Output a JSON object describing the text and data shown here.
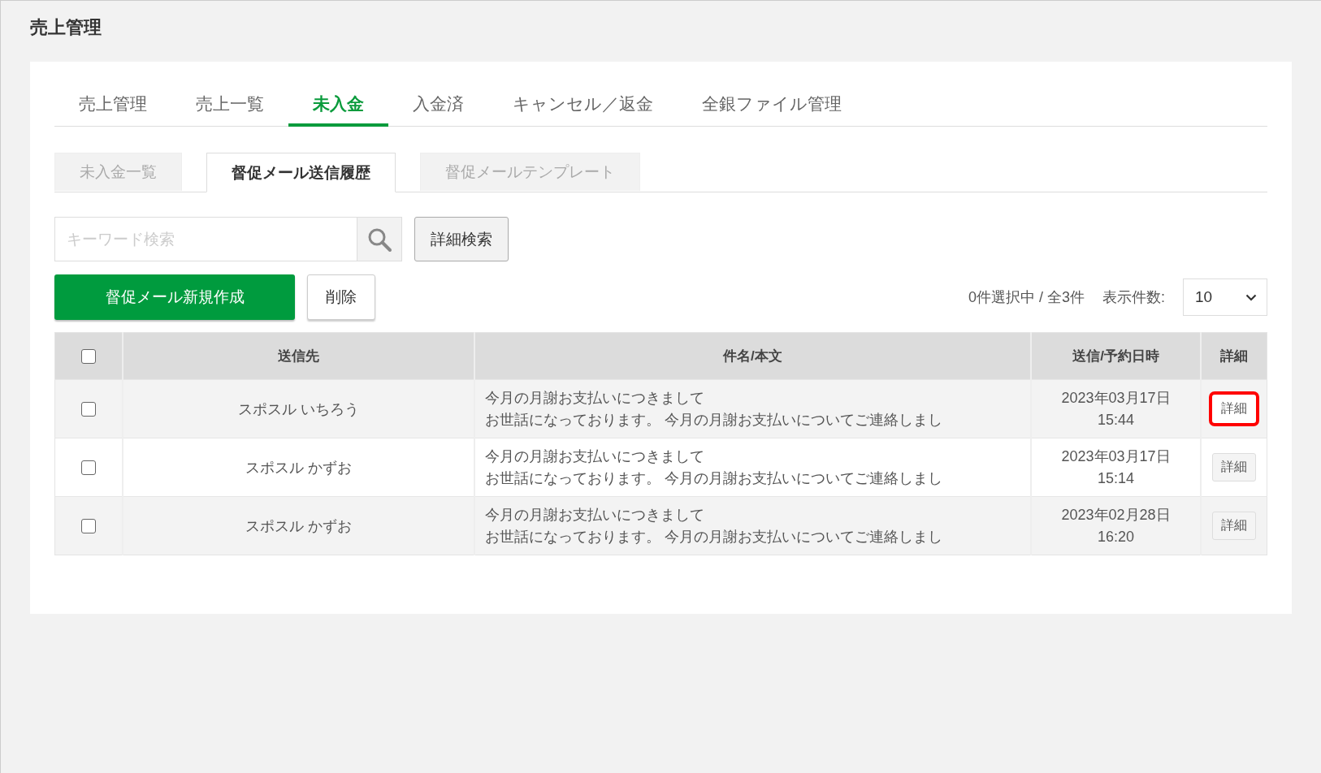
{
  "page_title": "売上管理",
  "tabs": [
    {
      "label": "売上管理",
      "selected": false
    },
    {
      "label": "売上一覧",
      "selected": false
    },
    {
      "label": "未入金",
      "selected": true
    },
    {
      "label": "入金済",
      "selected": false
    },
    {
      "label": "キャンセル／返金",
      "selected": false
    },
    {
      "label": "全銀ファイル管理",
      "selected": false
    }
  ],
  "sub_tabs": [
    {
      "label": "未入金一覧",
      "selected": false
    },
    {
      "label": "督促メール送信履歴",
      "selected": true
    },
    {
      "label": "督促メールテンプレート",
      "selected": false
    }
  ],
  "search": {
    "placeholder": "キーワード検索"
  },
  "advanced_search_button": "詳細検索",
  "create_button": "督促メール新規作成",
  "delete_button": "削除",
  "selection_count": "0件選択中 / 全3件",
  "page_size": {
    "label": "表示件数:",
    "value": "10"
  },
  "table": {
    "select_all_checked": false,
    "columns": [
      "送信先",
      "件名/本文",
      "送信/予約日時",
      "詳細"
    ],
    "rows": [
      {
        "checked": false,
        "recipient": "スポスル いちろう",
        "subject": "今月の月謝お支払いにつきまして",
        "body": "お世話になっております。 今月の月謝お支払いについてご連絡しまし",
        "date": "2023年03月17日",
        "time": "15:44",
        "detail_button": "詳細",
        "highlighted": true
      },
      {
        "checked": false,
        "recipient": "スポスル かずお",
        "subject": "今月の月謝お支払いにつきまして",
        "body": "お世話になっております。 今月の月謝お支払いについてご連絡しまし",
        "date": "2023年03月17日",
        "time": "15:14",
        "detail_button": "詳細",
        "highlighted": false
      },
      {
        "checked": false,
        "recipient": "スポスル かずお",
        "subject": "今月の月謝お支払いにつきまして",
        "body": "お世話になっております。 今月の月謝お支払いについてご連絡しまし",
        "date": "2023年02月28日",
        "time": "16:20",
        "detail_button": "詳細",
        "highlighted": false
      }
    ]
  }
}
